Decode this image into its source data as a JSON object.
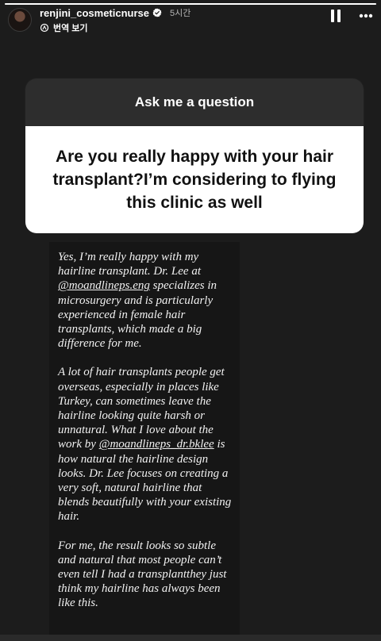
{
  "story": {
    "progress": 1.0,
    "username": "renjini_cosmeticnurse",
    "time": "5시간",
    "translate_label": "번역 보기"
  },
  "question_sticker": {
    "header": "Ask me a question",
    "question": "Are you really happy with your hair transplant?I’m considering to flying this clinic as well"
  },
  "answer": {
    "p1_a": "Yes, I’m really happy with my hairline transplant. Dr. Lee at ",
    "p1_handle": "@moandlineps.eng",
    "p1_b": " specializes in microsurgery and is particularly experienced in female hair transplants, which made a big difference for me.",
    "p2_a": "A lot of hair transplants people get overseas, especially in places like Turkey, can sometimes leave the hairline looking quite harsh or unnatural. What I love about the work by ",
    "p2_handle": "@moandlineps_dr.bklee",
    "p2_b": " is how natural the hairline design looks. Dr. Lee focuses on creating a very soft, natural hairline that blends beautifully with your existing hair.",
    "p3": "For me, the result looks so subtle and natural that most people can’t even tell I had a transplantthey just think my hairline has always been like this."
  },
  "icons": {
    "verified": "verified-badge-icon",
    "translate": "translate-icon",
    "pause": "pause-icon",
    "more": "more-icon"
  },
  "colors": {
    "background": "#1c1c1c",
    "sticker_header": "#2d2d2d",
    "sticker_body": "#ffffff",
    "verified": "#ffffff"
  }
}
